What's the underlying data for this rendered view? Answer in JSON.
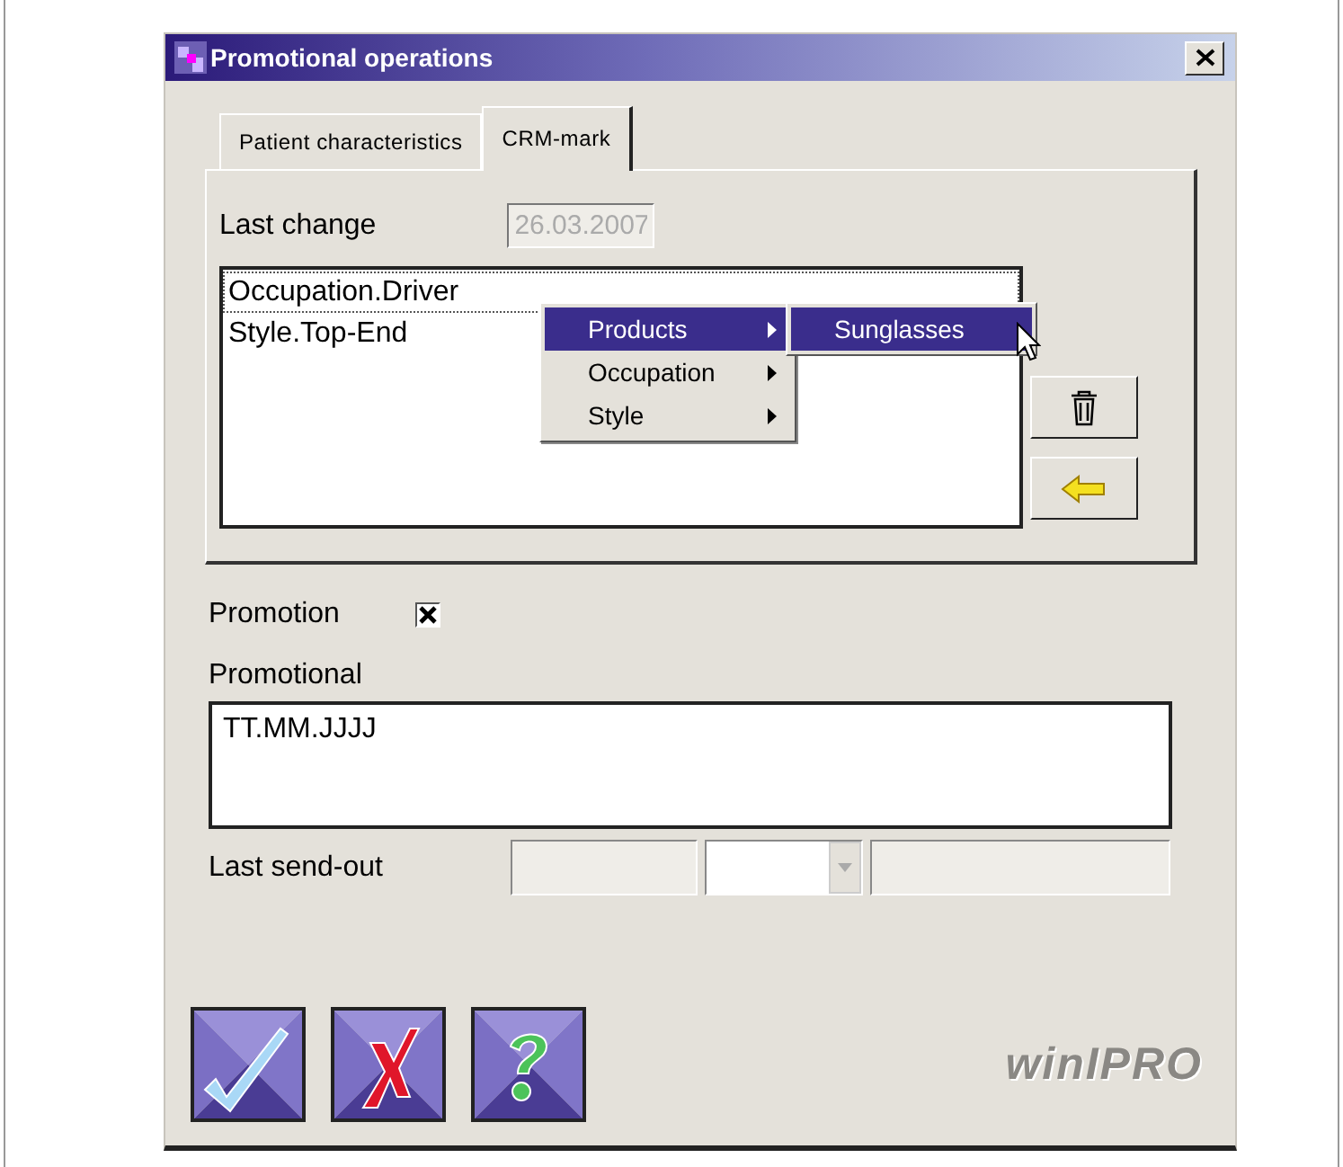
{
  "window": {
    "title": "Promotional operations"
  },
  "tabs": [
    {
      "label": "Patient characteristics",
      "selected": false
    },
    {
      "label": "CRM-mark",
      "selected": true
    }
  ],
  "last_change": {
    "label": "Last change",
    "value": "26.03.2007",
    "disabled": true
  },
  "marks_list": {
    "items": [
      {
        "label": "Occupation.Driver",
        "focused": true
      },
      {
        "label": "Style.Top-End",
        "focused": false
      }
    ]
  },
  "context_menu": {
    "items": [
      {
        "label": "Products",
        "selected": true,
        "submenu": true
      },
      {
        "label": "Occupation",
        "selected": false,
        "submenu": true
      },
      {
        "label": "Style",
        "selected": false,
        "submenu": true
      }
    ]
  },
  "submenu": {
    "items": [
      {
        "label": "Sunglasses",
        "selected": true
      }
    ]
  },
  "promotion": {
    "label": "Promotion",
    "checked": true
  },
  "promotional": {
    "label": "Promotional",
    "value": "TT.MM.JJJJ"
  },
  "last_send_out": {
    "label": "Last send-out"
  },
  "logo": "winIPRO"
}
